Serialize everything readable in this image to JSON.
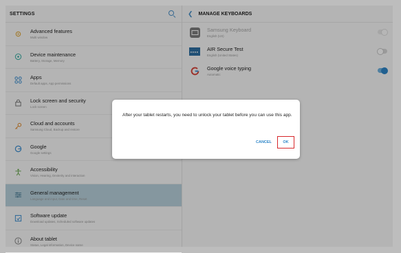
{
  "settings": {
    "title": "SETTINGS",
    "items": [
      {
        "label": "Advanced features",
        "sub": "Multi window",
        "icon": "advanced-features-icon"
      },
      {
        "label": "Device maintenance",
        "sub": "Battery, Storage, Memory",
        "icon": "device-maintenance-icon"
      },
      {
        "label": "Apps",
        "sub": "Default apps, App permissions",
        "icon": "apps-icon"
      },
      {
        "label": "Lock screen and security",
        "sub": "Lock screen",
        "icon": "lock-icon"
      },
      {
        "label": "Cloud and accounts",
        "sub": "Samsung Cloud, Backup and restore",
        "icon": "key-icon"
      },
      {
        "label": "Google",
        "sub": "Google settings",
        "icon": "google-icon"
      },
      {
        "label": "Accessibility",
        "sub": "Vision, Hearing, Dexterity and interaction",
        "icon": "accessibility-icon"
      },
      {
        "label": "General management",
        "sub": "Language and input, Date and time, Reset",
        "icon": "general-management-icon"
      },
      {
        "label": "Software update",
        "sub": "Download updates, Scheduled software updates",
        "icon": "software-update-icon"
      },
      {
        "label": "About tablet",
        "sub": "Status, Legal information, Device name",
        "icon": "info-icon"
      }
    ]
  },
  "keyboards": {
    "title": "MANAGE KEYBOARDS",
    "items": [
      {
        "label": "Samsung Keyboard",
        "sub": "English (US)",
        "state": "on-disabled"
      },
      {
        "label": "AIR Secure Test",
        "sub": "English (United States)",
        "state": "off"
      },
      {
        "label": "Google voice typing",
        "sub": "Automatic",
        "state": "on"
      }
    ]
  },
  "dialog": {
    "message": "After your tablet restarts, you need to unlock your tablet before you can use this app.",
    "cancel": "CANCEL",
    "ok": "OK"
  },
  "colors": {
    "accent": "#2e86c8",
    "highlight": "#d7262a",
    "active_item": "#b9d2dd"
  }
}
